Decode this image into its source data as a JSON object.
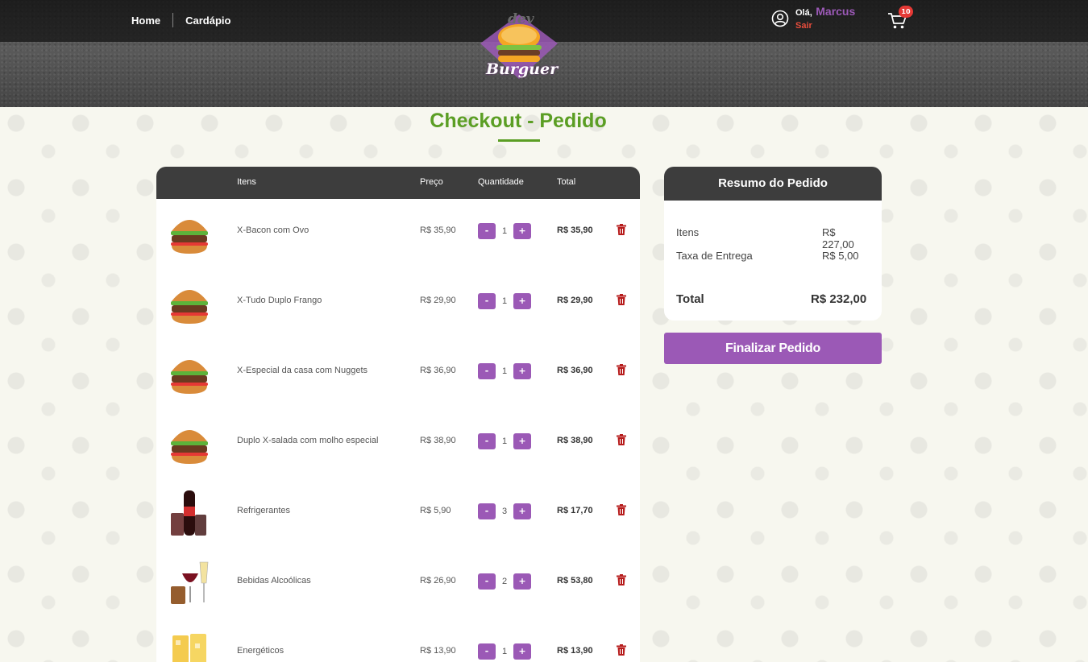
{
  "nav": {
    "home": "Home",
    "menu": "Cardápio"
  },
  "logo": {
    "top_text": "dev",
    "bottom_text": "Burguer"
  },
  "user": {
    "greeting": "Olá,",
    "name": "Marcus",
    "logout": "Sair"
  },
  "cart": {
    "count": "10"
  },
  "page": {
    "title": "Checkout - Pedido"
  },
  "table": {
    "headers": {
      "items": "Itens",
      "price": "Preço",
      "quantity": "Quantidade",
      "total": "Total"
    },
    "rows": [
      {
        "name": "X-Bacon com Ovo",
        "price": "R$ 35,90",
        "qty": "1",
        "total": "R$ 35,90",
        "image": "burger-icon"
      },
      {
        "name": "X-Tudo Duplo Frango",
        "price": "R$ 29,90",
        "qty": "1",
        "total": "R$ 29,90",
        "image": "burger-icon"
      },
      {
        "name": "X-Especial da casa com Nuggets",
        "price": "R$ 36,90",
        "qty": "1",
        "total": "R$ 36,90",
        "image": "burger-icon"
      },
      {
        "name": "Duplo X-salada com molho especial",
        "price": "R$ 38,90",
        "qty": "1",
        "total": "R$ 38,90",
        "image": "burger-icon"
      },
      {
        "name": "Refrigerantes",
        "price": "R$ 5,90",
        "qty": "3",
        "total": "R$ 17,70",
        "image": "soda-icon"
      },
      {
        "name": "Bebidas Alcoólicas",
        "price": "R$ 26,90",
        "qty": "2",
        "total": "R$ 53,80",
        "image": "drinks-icon"
      },
      {
        "name": "Energéticos",
        "price": "R$ 13,90",
        "qty": "1",
        "total": "R$ 13,90",
        "image": "energy-drink-icon"
      }
    ],
    "minus_label": "-",
    "plus_label": "+"
  },
  "summary": {
    "title": "Resumo do Pedido",
    "items_label": "Itens",
    "items_value": "R$ 227,00",
    "delivery_label": "Taxa de Entrega",
    "delivery_value": "R$ 5,00",
    "total_label": "Total",
    "total_value": "R$ 232,00",
    "finish_button": "Finalizar Pedido"
  },
  "colors": {
    "accent": "#9b59b6",
    "title_green": "#5b9e24",
    "dark": "#3d3d3d",
    "danger": "#b71c1c"
  }
}
